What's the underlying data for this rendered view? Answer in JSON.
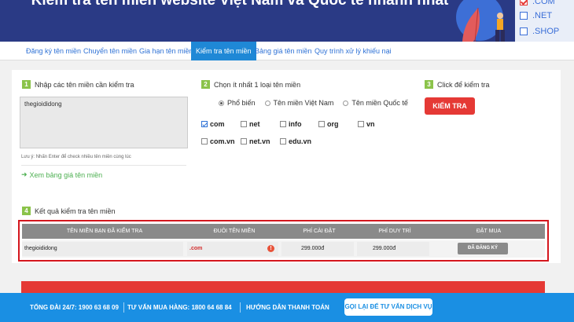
{
  "hero": {
    "title": "Kiểm tra tên miền website Việt Nam và Quốc tế nhanh nhất",
    "extensions": [
      ".COM",
      ".NET",
      ".SHOP"
    ]
  },
  "tabs": [
    {
      "label": "Đăng ký tên miền",
      "active": false
    },
    {
      "label": "Chuyển tên miền",
      "active": false
    },
    {
      "label": "Gia hạn tên miền",
      "active": false
    },
    {
      "label": "Kiểm tra tên miền",
      "active": true
    },
    {
      "label": "Bảng giá tên miền",
      "active": false
    },
    {
      "label": "Quy trình xử lý khiếu nại",
      "active": false
    }
  ],
  "step1": {
    "num": "1",
    "label": "Nhập các tên miền cần kiểm tra",
    "value": "thegioididong",
    "hint": "Lưu ý: Nhấn Enter để check nhiều tên miền cùng lúc",
    "view_prices": "Xem bảng giá tên miền"
  },
  "step2": {
    "num": "2",
    "label": "Chọn ít nhất 1 loại tên miền",
    "radios": [
      "Phổ biến",
      "Tên miền Việt Nam",
      "Tên miền Quốc tế"
    ],
    "selected_radio": "Phổ biến",
    "tlds": [
      {
        "label": "com",
        "checked": true
      },
      {
        "label": "net",
        "checked": false
      },
      {
        "label": "info",
        "checked": false
      },
      {
        "label": "org",
        "checked": false
      },
      {
        "label": "vn",
        "checked": false
      },
      {
        "label": "com.vn",
        "checked": false
      },
      {
        "label": "net.vn",
        "checked": false
      },
      {
        "label": "edu.vn",
        "checked": false
      }
    ]
  },
  "step3": {
    "num": "3",
    "label": "Click để kiểm tra",
    "button": "KIỂM TRA"
  },
  "results": {
    "num": "4",
    "label": "Kết quả kiểm tra tên miền",
    "headers": [
      "TÊN MIỀN BẠN ĐÃ KIỂM TRA",
      "ĐUÔI TÊN MIỀN",
      "PHÍ CÀI ĐẶT",
      "PHÍ DUY TRÌ",
      "ĐẶT MUA"
    ],
    "row": {
      "domain": "thegioididong",
      "tld": ".com",
      "setup_fee": "299.000đ",
      "maintenance_fee": "299.000đ",
      "status": "ĐÃ ĐĂNG KÝ"
    }
  },
  "footer": {
    "hotline": "TỔNG ĐÀI 24/7: 1900 63 68 09",
    "sales": "TƯ VẤN MUA HÀNG: 1800 64 68 84",
    "guide": "HƯỚNG DẪN THANH TOÁN",
    "callback": "GỌI LẠI ĐỂ TƯ VẤN DỊCH VỤ"
  },
  "colors": {
    "hero_bg": "#2a3a85",
    "accent_blue": "#1f88d6",
    "red": "#e53935",
    "step_green": "#8bc34a",
    "footer_bg": "#1a8fe3"
  }
}
